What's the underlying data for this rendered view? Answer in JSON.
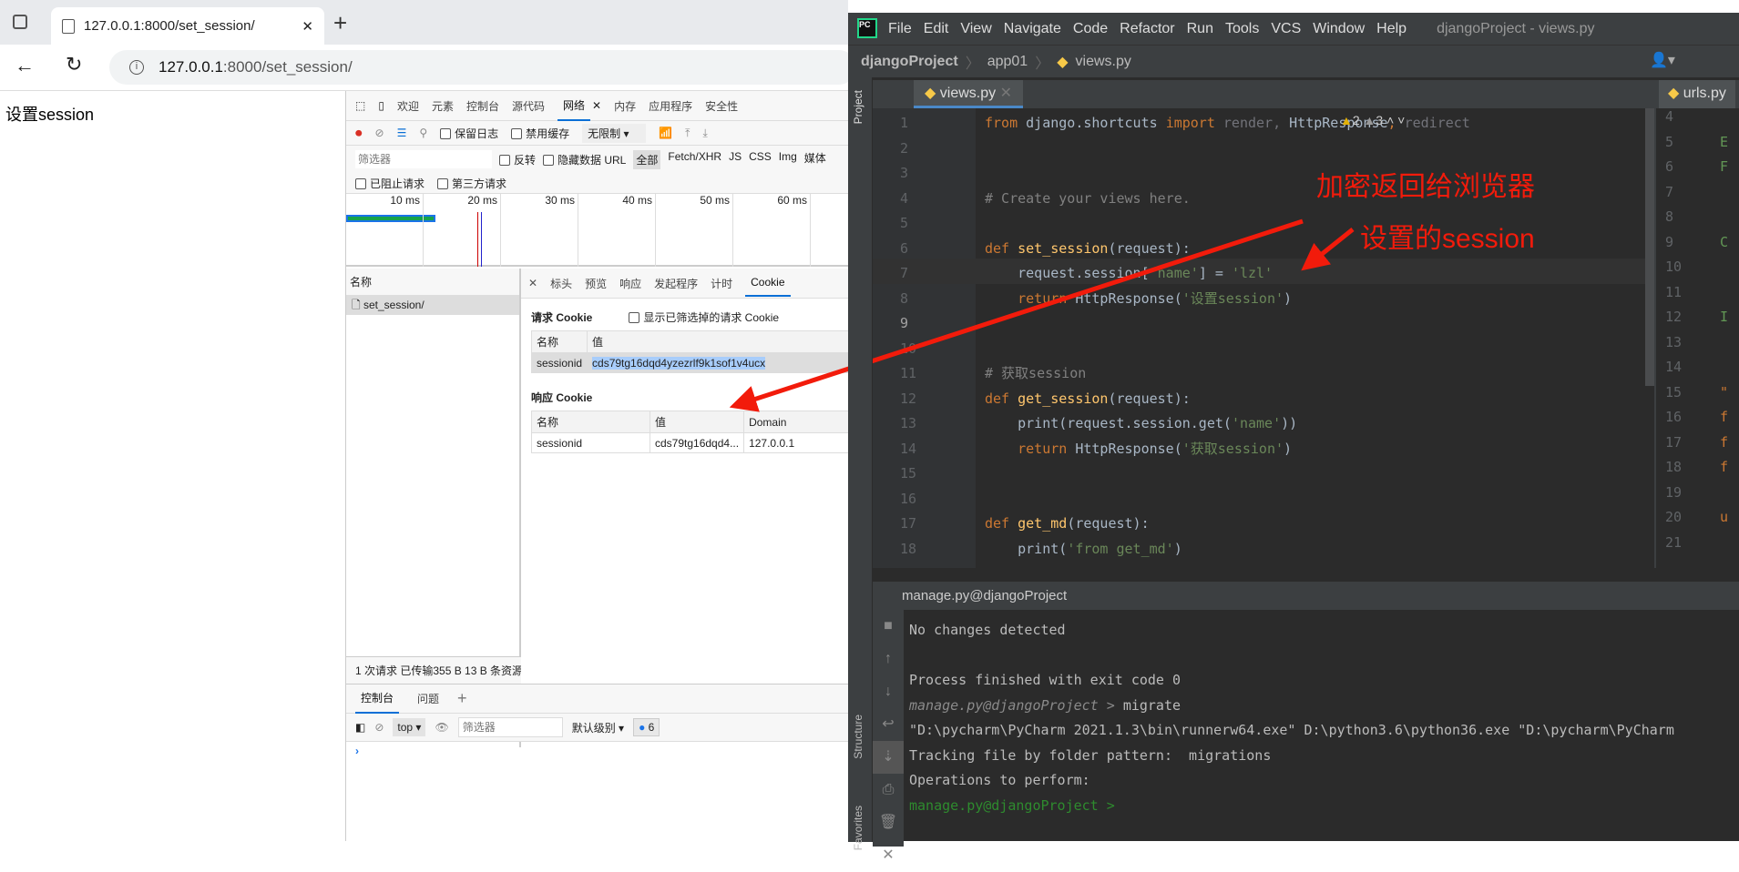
{
  "browser": {
    "tab_title": "127.0.0.1:8000/set_session/",
    "url_host": "127.0.0.1",
    "url_rest": ":8000/set_session/",
    "page_text": "设置session"
  },
  "devtools": {
    "tabs": [
      "欢迎",
      "元素",
      "控制台",
      "源代码",
      "网络",
      "内存",
      "应用程序",
      "安全性"
    ],
    "active_tab": "网络",
    "toolbar": {
      "preserve_log": "保留日志",
      "disable_cache": "禁用缓存",
      "throttle": "无限制"
    },
    "filter": {
      "placeholder": "筛选器",
      "invert": "反转",
      "hide_data_url": "隐藏数据 URL",
      "types": [
        "全部",
        "Fetch/XHR",
        "JS",
        "CSS",
        "Img",
        "媒体"
      ],
      "blocked": "已阻止请求",
      "third_party": "第三方请求"
    },
    "timeline_ticks": [
      "10 ms",
      "20 ms",
      "30 ms",
      "40 ms",
      "50 ms",
      "60 ms"
    ],
    "name_header": "名称",
    "requests": [
      "set_session/"
    ],
    "detail_tabs": [
      "标头",
      "预览",
      "响应",
      "发起程序",
      "计时",
      "Cookie"
    ],
    "active_detail": "Cookie",
    "request_cookie": {
      "title": "请求 Cookie",
      "show_filtered": "显示已筛选掉的请求 Cookie",
      "headers": [
        "名称",
        "值"
      ],
      "rows": [
        [
          "sessionid",
          "cds79tg16dqd4yzezrlf9k1sof1v4ucx"
        ]
      ]
    },
    "response_cookie": {
      "title": "响应 Cookie",
      "headers": [
        "名称",
        "值",
        "Domain"
      ],
      "rows": [
        [
          "sessionid",
          "cds79tg16dqd4...",
          "127.0.0.1"
        ]
      ]
    },
    "status": "1 次请求  已传输355 B  13 B 条资源",
    "drawer": {
      "tabs": [
        "控制台",
        "问题"
      ],
      "context": "top",
      "filter_placeholder": "筛选器",
      "level": "默认级别",
      "badge": "6"
    }
  },
  "ide": {
    "menu": [
      "File",
      "Edit",
      "View",
      "Navigate",
      "Code",
      "Refactor",
      "Run",
      "Tools",
      "VCS",
      "Window",
      "Help"
    ],
    "title": "djangoProject - views.py",
    "breadcrumb": [
      "djangoProject",
      "app01",
      "views.py"
    ],
    "tabs": [
      "views.py",
      "urls.py"
    ],
    "side_labels": [
      "Project",
      "Structure",
      "Favorites"
    ],
    "inspections": {
      "warnings": "2",
      "weak": "3"
    },
    "code": [
      [
        [
          "from",
          "k"
        ],
        [
          " django.shortcuts ",
          ""
        ],
        [
          "import",
          "k"
        ],
        [
          " render, ",
          "g"
        ],
        [
          "HttpResponse",
          ""
        ],
        [
          ", ",
          "k"
        ],
        [
          "redirect",
          "g"
        ]
      ],
      [],
      [],
      [
        [
          "# Create your views here.",
          "c"
        ]
      ],
      [],
      [
        [
          "def",
          "k"
        ],
        [
          " ",
          ""
        ],
        [
          "set_session",
          "f"
        ],
        [
          "(request):",
          ""
        ]
      ],
      [
        [
          "    request.session[",
          ""
        ],
        [
          "'name'",
          "s"
        ],
        [
          "] = ",
          ""
        ],
        [
          "'lzl'",
          "s"
        ]
      ],
      [
        [
          "    ",
          ""
        ],
        [
          "return",
          "k"
        ],
        [
          " HttpResponse(",
          ""
        ],
        [
          "'设置session'",
          "s"
        ],
        [
          ")",
          ""
        ]
      ],
      [],
      [],
      [
        [
          "# 获取session",
          "c"
        ]
      ],
      [
        [
          "def",
          "k"
        ],
        [
          " ",
          ""
        ],
        [
          "get_session",
          "f"
        ],
        [
          "(request):",
          ""
        ]
      ],
      [
        [
          "    print(request.session.get(",
          ""
        ],
        [
          "'name'",
          "s"
        ],
        [
          "))",
          ""
        ]
      ],
      [
        [
          "    ",
          ""
        ],
        [
          "return",
          "k"
        ],
        [
          " HttpResponse(",
          ""
        ],
        [
          "'获取session'",
          "s"
        ],
        [
          ")",
          ""
        ]
      ],
      [],
      [],
      [
        [
          "def",
          "k"
        ],
        [
          " ",
          ""
        ],
        [
          "get_md",
          "f"
        ],
        [
          "(request):",
          ""
        ]
      ],
      [
        [
          "    print(",
          ""
        ],
        [
          "'from get_md'",
          "s"
        ],
        [
          ")",
          ""
        ]
      ]
    ],
    "right_line_numbers": [
      "4",
      "5",
      "6",
      "7",
      "8",
      "9",
      "10",
      "11",
      "12",
      "13",
      "14",
      "15",
      "16",
      "17",
      "18",
      "19",
      "20",
      "21"
    ],
    "right_code": [
      "",
      "E",
      "F",
      "",
      "",
      "C",
      "",
      "",
      "I",
      "",
      "",
      "\"",
      "f",
      "f",
      "f",
      "",
      "u",
      ""
    ],
    "terminal": {
      "title": "manage.py@djangoProject",
      "lines": [
        [
          "No changes detected",
          ""
        ],
        [
          "",
          ""
        ],
        [
          "Process finished with exit code 0",
          ""
        ],
        [
          "manage.py@djangoProject > |migrate",
          "prompt"
        ],
        [
          "\"D:\\pycharm\\PyCharm 2021.1.3\\bin\\runnerw64.exe\" D:\\python3.6\\python36.exe \"D:\\pycharm\\PyCharm",
          ""
        ],
        [
          "Tracking file by folder pattern:  migrations",
          ""
        ],
        [
          "Operations to perform:",
          ""
        ],
        [
          "manage.py@djangoProject > ",
          "green"
        ]
      ]
    }
  },
  "annotations": [
    "加密返回给浏览器",
    "设置的session"
  ],
  "colors": {
    "annotation": "#f21b0b",
    "keyword": "#cc7832",
    "string": "#6a8759",
    "accent": "#0a6fd6"
  }
}
